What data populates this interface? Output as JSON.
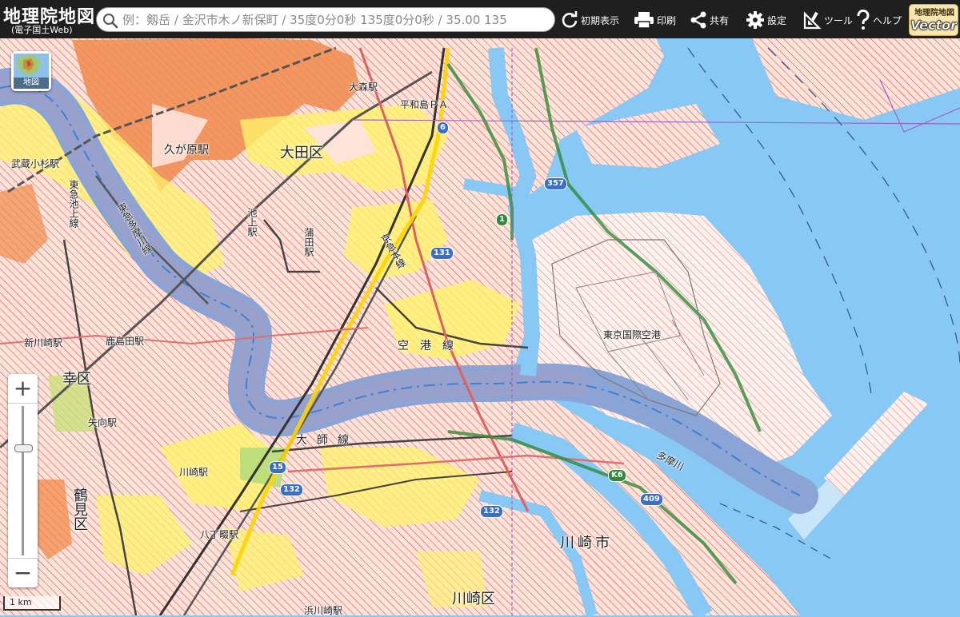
{
  "header": {
    "logo_title": "地理院地図",
    "logo_subtitle": "(電子国土Web)",
    "search_placeholder": "例：剱岳 / 金沢市木ノ新保町 / 35度0分0秒 135度0分0秒 / 35.00 135",
    "buttons": [
      {
        "id": "initial-view",
        "label": "初期表示",
        "icon": "refresh-icon"
      },
      {
        "id": "print",
        "label": "印刷",
        "icon": "printer-icon"
      },
      {
        "id": "share",
        "label": "共有",
        "icon": "share-icon"
      },
      {
        "id": "settings",
        "label": "設定",
        "icon": "gear-icon"
      },
      {
        "id": "tools",
        "label": "ツール",
        "icon": "tools-icon"
      },
      {
        "id": "help",
        "label": "ヘルプ",
        "icon": "question-icon"
      }
    ],
    "badge_top": "地理院地図",
    "badge_bottom": "Vector"
  },
  "layer_button": {
    "label": "地図"
  },
  "zoom": {
    "in_label": "+",
    "out_label": "−"
  },
  "scale": {
    "label": "1 km"
  },
  "map_labels": {
    "ota_ku": "大田区",
    "kugahara": "久が原駅",
    "omori": "大森駅",
    "heiwajima": "平和島ＰＡ",
    "musashi_kosugi": "武蔵小杉駅",
    "ikegami": "池上駅",
    "kamata": "蒲田駅",
    "kuko_line": "空港線",
    "airport": "東京国際空港",
    "shin_kawasaki": "新川崎駅",
    "kashimada": "鹿島田駅",
    "saiwai_ku": "幸区",
    "yako": "矢向駅",
    "daishi_line": "大師線",
    "kawasaki_st": "川崎駅",
    "tsurumi_ku": "鶴見区",
    "hatchonawate": "八丁畷駅",
    "kawasaki_shi": "川崎市",
    "kawasaki_ku": "川崎区",
    "tamagawa": "多摩川",
    "line_vertical": "東急池上線",
    "line_vertical2": "東急多摩川線",
    "keikyu": "京急本線",
    "hamakawasaki": "浜川崎駅"
  },
  "route_shields": {
    "r15": "15",
    "r131": "131",
    "r132a": "132",
    "r132b": "132",
    "r357": "357",
    "r409": "409",
    "r6": "6",
    "rk6": "K6",
    "r1": "1"
  },
  "colors": {
    "sea": "#87c8f5",
    "land_urban": "#fde0d8",
    "hatch_red": "#e8413a",
    "orange_area": "#f08a4b",
    "yellow_area": "#fff36a",
    "river": "#8aa4d6",
    "header_bg": "#1f1f1f"
  }
}
